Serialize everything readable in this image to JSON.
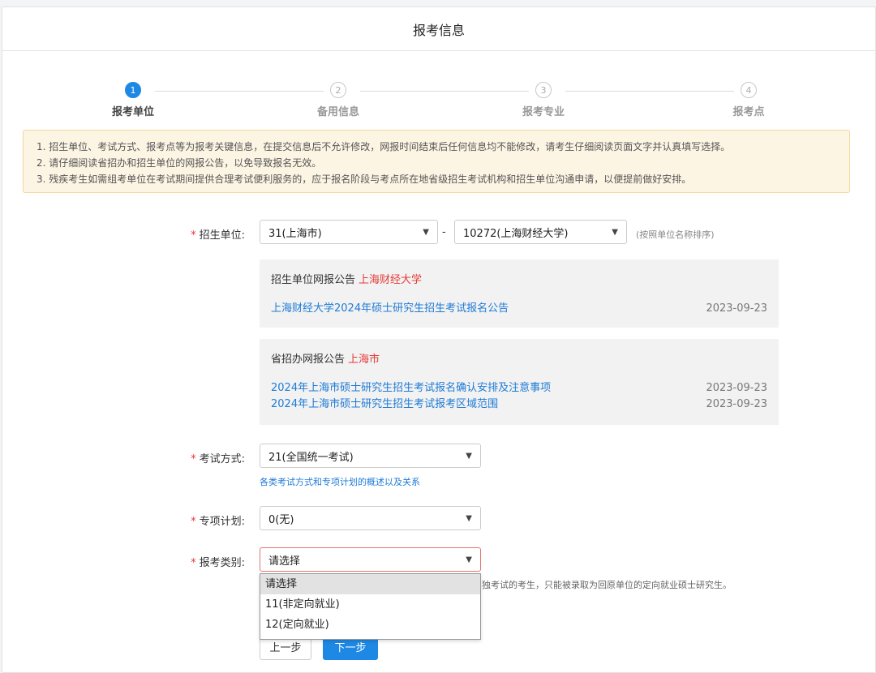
{
  "header": {
    "title": "报考信息"
  },
  "steps": [
    {
      "num": "1",
      "label": "报考单位"
    },
    {
      "num": "2",
      "label": "备用信息"
    },
    {
      "num": "3",
      "label": "报考专业"
    },
    {
      "num": "4",
      "label": "报考点"
    }
  ],
  "notice": [
    "1. 招生单位、考试方式、报考点等为报考关键信息，在提交信息后不允许修改，网报时间结束后任何信息均不能修改，请考生仔细阅读页面文字并认真填写选择。",
    "2. 请仔细阅读省招办和招生单位的网报公告，以免导致报名无效。",
    "3. 残疾考生如需组考单位在考试期间提供合理考试便利服务的，应于报名阶段与考点所在地省级招生考试机构和招生单位沟通申请，以便提前做好安排。"
  ],
  "form": {
    "unit": {
      "label": "招生单位:",
      "province": "31(上海市)",
      "dash": "-",
      "school": "10272(上海财经大学)",
      "hint": "(按照单位名称排序)"
    },
    "exam_mode": {
      "label": "考试方式:",
      "value": "21(全国统一考试)",
      "link": "各类考试方式和专项计划的概述以及关系"
    },
    "special_plan": {
      "label": "专项计划:",
      "value": "0(无)"
    },
    "category": {
      "label": "报考类别:",
      "value": "请选择",
      "options": [
        "请选择",
        "11(非定向就业)",
        "12(定向就业)"
      ],
      "hint": "独考试的考生，只能被录取为回原单位的定向就业硕士研究生。"
    }
  },
  "school_panel": {
    "title": "招生单位网报公告",
    "highlight": "上海财经大学",
    "items": [
      {
        "text": "上海财经大学2024年硕士研究生招生考试报名公告",
        "date": "2023-09-23"
      }
    ]
  },
  "province_panel": {
    "title": "省招办网报公告",
    "highlight": "上海市",
    "items": [
      {
        "text": "2024年上海市硕士研究生招生考试报名确认安排及注意事项",
        "date": "2023-09-23"
      },
      {
        "text": "2024年上海市硕士研究生招生考试报考区域范围",
        "date": "2023-09-23"
      }
    ]
  },
  "buttons": {
    "prev": "上一步",
    "next": "下一步"
  },
  "colors": {
    "primary": "#1e88e5",
    "required": "#e53935",
    "notice_bg": "#fdf5e4",
    "link": "#1e7bd6"
  }
}
